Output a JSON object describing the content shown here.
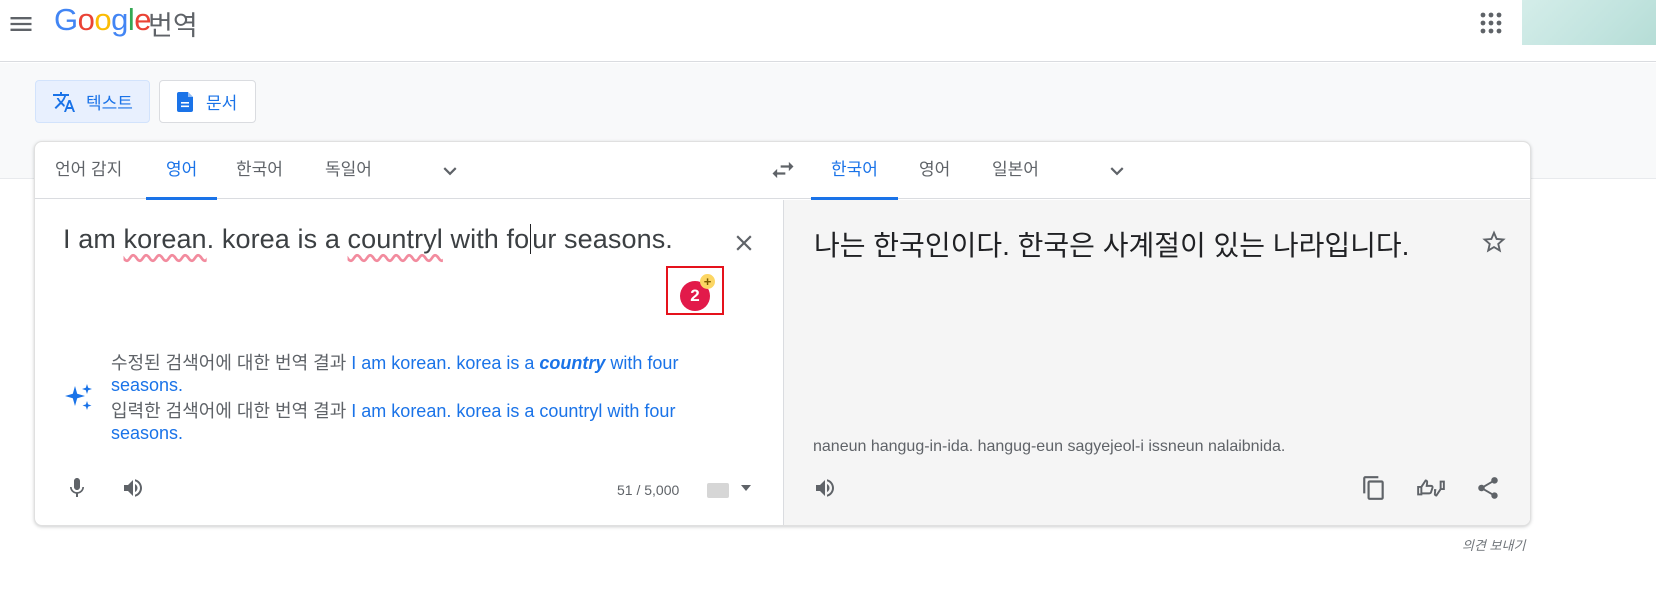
{
  "header": {
    "logo_parts": [
      "G",
      "o",
      "o",
      "g",
      "l",
      "e"
    ],
    "product_name": "번역"
  },
  "modes": [
    {
      "label": "텍스트",
      "active": true
    },
    {
      "label": "문서",
      "active": false
    }
  ],
  "source": {
    "languages": [
      "언어 감지",
      "영어",
      "한국어",
      "독일어"
    ],
    "active_index": 1,
    "text_parts": [
      "I am ",
      "korean",
      ". korea is a ",
      "countryl",
      " with fo",
      "ur seasons."
    ],
    "badge": {
      "count": "2",
      "plus": "+"
    },
    "suggestion_corrected": {
      "prefix": "수정된 검색어에 대한 번역 결과 ",
      "link_before": "I am korean. korea is a ",
      "link_em": "country",
      "link_after": " with four seasons."
    },
    "suggestion_original": {
      "prefix": "입력한 검색어에 대한 번역 결과 ",
      "link": "I am korean. korea is a countryl with four seasons."
    },
    "char_count": "51 / 5,000"
  },
  "target": {
    "languages": [
      "한국어",
      "영어",
      "일본어"
    ],
    "active_index": 0,
    "text": "나는 한국인이다. 한국은 사계절이 있는 나라입니다.",
    "romanization": "naneun hangug-in-ida. hangug-eun sagyejeol-i issneun nalaibnida."
  },
  "footer": {
    "feedback": "의견 보내기"
  },
  "colors": {
    "accent": "#1a73e8",
    "badge": "#e21a4a",
    "highlight": "#e5121c"
  }
}
